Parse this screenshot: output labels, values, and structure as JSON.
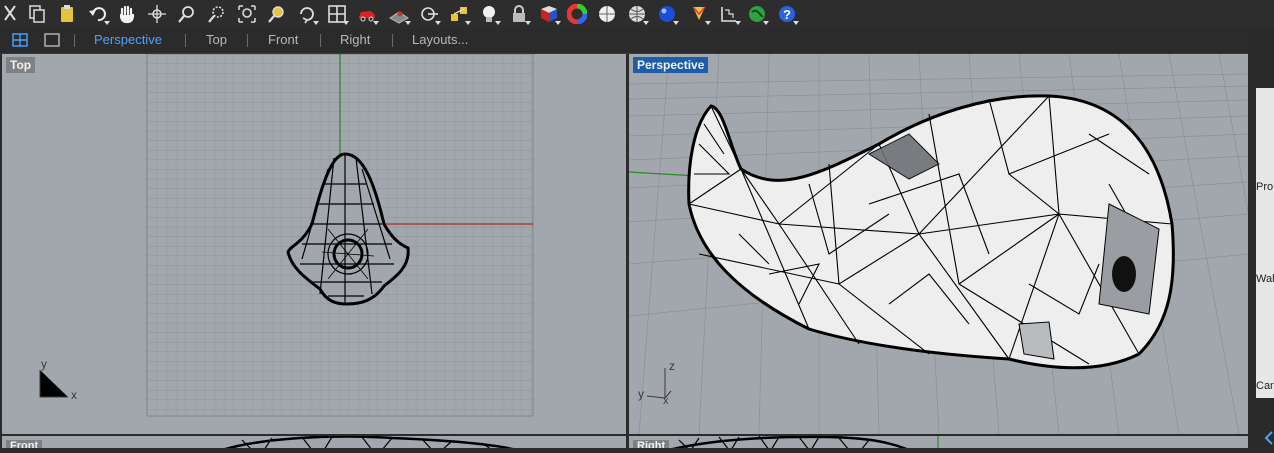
{
  "toolbar": {
    "icons": [
      "scissors-icon",
      "copy-icon",
      "paste-icon",
      "undo-icon",
      "pan-hand-icon",
      "rotate-view-icon",
      "zoom-icon",
      "zoom-window-icon",
      "zoom-extents-icon",
      "zoom-selected-icon",
      "rotate-camera-icon",
      "viewport-layout-icon",
      "car-icon",
      "ground-plane-icon",
      "target-icon",
      "snap-icon",
      "light-bulb-icon",
      "lock-icon",
      "material-icon",
      "color-wheel-icon",
      "sphere-icon",
      "render-sphere-icon",
      "blue-sphere-icon",
      "pen-icon",
      "grid-dims-icon",
      "green-globe-icon",
      "help-icon"
    ]
  },
  "tabs": {
    "perspective": "Perspective",
    "top": "Top",
    "front": "Front",
    "right": "Right",
    "layouts": "Layouts..."
  },
  "viewports": {
    "top": {
      "title": "Top",
      "axis_y": "y",
      "axis_x": "x"
    },
    "perspective": {
      "title": "Perspective",
      "axis_z": "z",
      "axis_y": "y",
      "axis_x": "x"
    },
    "front": {
      "title": "Front"
    },
    "right": {
      "title": "Right"
    }
  },
  "right_panel": {
    "labels": [
      "Pro",
      "Wal",
      "Car"
    ]
  },
  "colors": {
    "viewport_bg": "#a2a7ad",
    "grid_major": "#7e838a",
    "active_title": "#1e5ea8",
    "tab_active": "#4aa3ff",
    "x_axis": "#b02a2a",
    "y_axis": "#2a8a2a"
  }
}
